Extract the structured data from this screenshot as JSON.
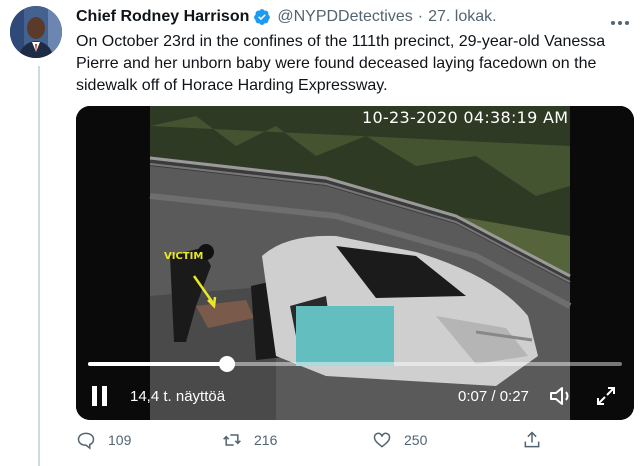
{
  "tweet": {
    "author_name": "Chief Rodney Harrison",
    "author_handle": "@NYPDDetectives",
    "separator": "·",
    "date": "27. lokak.",
    "text": "On October 23rd in the confines of the 111th precinct, 29-year-old Vanessa Pierre and her unborn baby were found deceased laying facedown on the sidewalk off of Horace Harding Expressway."
  },
  "media": {
    "timestamp": "10-23-2020 04:38:19 AM",
    "overlay_label": "VICTIM",
    "views": "14,4 t. näyttöä",
    "time": "0:07 / 0:27",
    "progress": 0.26
  },
  "actions": {
    "replies": "109",
    "retweets": "216",
    "likes": "250"
  },
  "colors": {
    "verified": "#1d9bf0",
    "secondary_text": "#536471",
    "label_yellow": "#e8e82a"
  },
  "icons": [
    "verified-badge-icon",
    "more-icon",
    "pause-icon",
    "volume-icon",
    "fullscreen-icon",
    "reply-icon",
    "retweet-icon",
    "like-icon",
    "share-icon"
  ]
}
